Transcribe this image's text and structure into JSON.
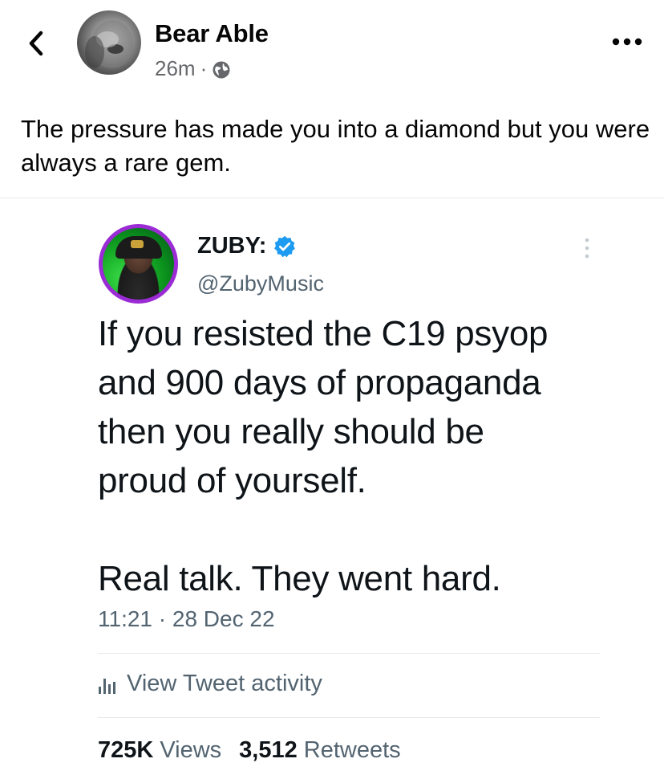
{
  "post": {
    "author": "Bear Able",
    "time": "26m",
    "separator": "·",
    "caption": "The pressure has made you into a diamond but you were always a rare gem."
  },
  "icons": {
    "back": "back-chevron-icon",
    "audience": "globe-icon",
    "more": "more-dots-icon"
  },
  "tweet": {
    "display_name": "ZUBY:",
    "handle": "@ZubyMusic",
    "body_lines": [
      "If you resisted the C19 psyop",
      "and 900 days of propaganda",
      "then you really should be",
      "proud of yourself."
    ],
    "body_last": "Real talk. They went hard.",
    "timestamp": "11:21 · 28 Dec 22",
    "activity_label": "View Tweet activity",
    "views_count": "725K",
    "views_label": "Views",
    "retweets_count": "3,512",
    "retweets_label": "Retweets"
  },
  "colors": {
    "text_primary": "#050505",
    "text_secondary": "#65676b",
    "tweet_secondary": "#536471",
    "verified_blue": "#1d9bf0",
    "avatar_ring": "#9b2bd4"
  }
}
